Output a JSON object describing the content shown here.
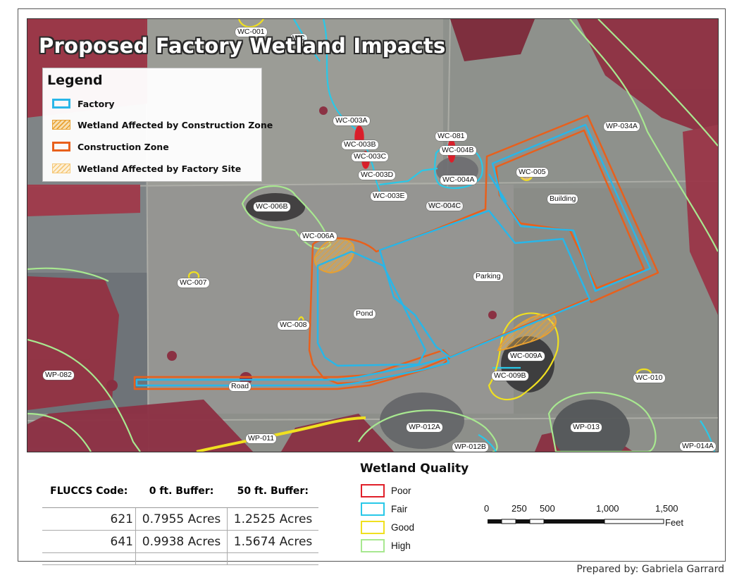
{
  "map": {
    "title": "Proposed Factory Wetland Impacts",
    "labels": {
      "wc001": "WC-001",
      "wc_partial": "WC",
      "wc003a": "WC-003A",
      "wc003b": "WC-003B",
      "wc003c": "WC-003C",
      "wc003d": "WC-003D",
      "wc003e": "WC-003E",
      "wc081": "WC-081",
      "wc004b": "WC-004B",
      "wc004a": "WC-004A",
      "wc004c": "WC-004C",
      "wc005": "WC-005",
      "wc006b": "WC-006B",
      "wc006a": "WC-006A",
      "wc007": "WC-007",
      "wc008": "WC-008",
      "wc009a": "WC-009A",
      "wc009b": "WC-009B",
      "wc010": "WC-010",
      "wp034a": "WP-034A",
      "wp082": "WP-082",
      "wp011": "WP-011",
      "wp012a": "WP-012A",
      "wp012b": "WP-012B",
      "wp013": "WP-013",
      "wp014a": "WP-014A",
      "building": "Building",
      "parking": "Parking",
      "pond": "Pond",
      "road": "Road"
    }
  },
  "legend": {
    "title": "Legend",
    "items": [
      {
        "label": "Factory",
        "color": "#29b6e8",
        "style": "outline"
      },
      {
        "label": "Wetland Affected by Construction Zone",
        "color": "#e8a030",
        "style": "hatch"
      },
      {
        "label": "Construction Zone",
        "color": "#e8601c",
        "style": "outline"
      },
      {
        "label": "Wetland Affected by Factory Site",
        "color": "#f5c878",
        "style": "hatch"
      }
    ]
  },
  "table": {
    "headers": [
      "FLUCCS Code:",
      "0 ft. Buffer:",
      "50 ft. Buffer:"
    ],
    "rows": [
      {
        "code": "621",
        "buf0": "0.7955 Acres",
        "buf50": "1.2525 Acres"
      },
      {
        "code": "641",
        "buf0": "0.9938 Acres",
        "buf50": "1.5674 Acres"
      }
    ]
  },
  "wetland_quality": {
    "title": "Wetland Quality",
    "items": [
      {
        "label": "Poor",
        "color": "#e0202a"
      },
      {
        "label": "Fair",
        "color": "#29c8e8"
      },
      {
        "label": "Good",
        "color": "#f0e020"
      },
      {
        "label": "High",
        "color": "#a8e890"
      }
    ]
  },
  "scale_bar": {
    "ticks": [
      "0",
      "250",
      "500",
      "1,000",
      "1,500"
    ],
    "unit": "Feet"
  },
  "footer": "Prepared by: Gabriela Garrard",
  "colors": {
    "factory": "#29b6e8",
    "construction": "#e8601c",
    "affected": "#f0b040",
    "poor": "#e0202a",
    "fair": "#29c8e8",
    "good": "#f0e020",
    "high": "#a8e890"
  }
}
